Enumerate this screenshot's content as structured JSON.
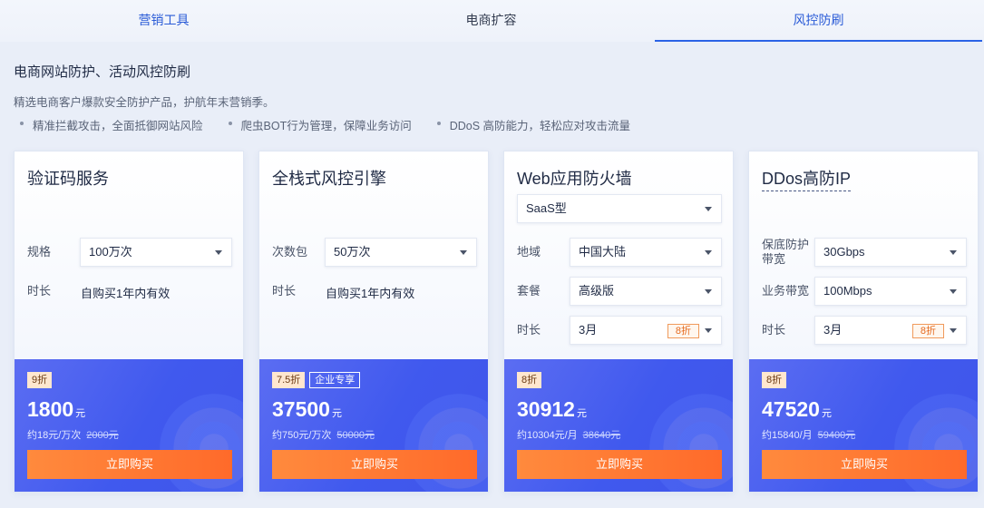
{
  "tabs": [
    {
      "label": "营销工具",
      "active": false
    },
    {
      "label": "电商扩容",
      "active": false
    },
    {
      "label": "风控防刷",
      "active": true
    }
  ],
  "intro": {
    "title": "电商网站防护、活动风控防刷",
    "description": "精选电商客户爆款安全防护产品，护航年末营销季。",
    "features": [
      "精准拦截攻击，全面抵御网站风险",
      "爬虫BOT行为管理，保障业务访问",
      "DDoS 高防能力，轻松应对攻击流量"
    ]
  },
  "cards": [
    {
      "title": "验证码服务",
      "rows": [
        {
          "label": "规格",
          "type": "select",
          "value": "100万次"
        },
        {
          "label": "时长",
          "type": "text",
          "value": "自购买1年内有效"
        }
      ],
      "discount": "9折",
      "price": "1800",
      "price_unit": "元",
      "unit_price": "约18元/万次",
      "original_price": "2000元",
      "buy_label": "立即购买"
    },
    {
      "title": "全栈式风控引擎",
      "rows": [
        {
          "label": "次数包",
          "type": "select",
          "value": "50万次"
        },
        {
          "label": "时长",
          "type": "text",
          "value": "自购买1年内有效"
        }
      ],
      "discount": "7.5折",
      "enterprise_tag": "企业专享",
      "price": "37500",
      "price_unit": "元",
      "unit_price": "约750元/万次",
      "original_price": "50000元",
      "buy_label": "立即购买"
    },
    {
      "title": "Web应用防火墙",
      "top_select": "SaaS型",
      "rows": [
        {
          "label": "地域",
          "type": "select",
          "value": "中国大陆"
        },
        {
          "label": "套餐",
          "type": "select",
          "value": "高级版"
        },
        {
          "label": "时长",
          "type": "select",
          "value": "3月",
          "tag": "8折"
        }
      ],
      "discount": "8折",
      "price": "30912",
      "price_unit": "元",
      "unit_price": "约10304元/月",
      "original_price": "38640元",
      "buy_label": "立即购买"
    },
    {
      "title": "DDos高防IP",
      "rows": [
        {
          "label": "保底防护带宽",
          "type": "select",
          "value": "30Gbps"
        },
        {
          "label": "业务带宽",
          "type": "select",
          "value": "100Mbps"
        },
        {
          "label": "时长",
          "type": "select",
          "value": "3月",
          "tag": "8折"
        }
      ],
      "discount": "8折",
      "price": "47520",
      "price_unit": "元",
      "unit_price": "约15840/月",
      "original_price": "59400元",
      "buy_label": "立即购买"
    }
  ],
  "colors": {
    "accent": "#2a63e6",
    "price_bg": "#4059ee",
    "buy_button": "#ff6a2a",
    "discount_tag_bg": "#ffe7cf"
  }
}
